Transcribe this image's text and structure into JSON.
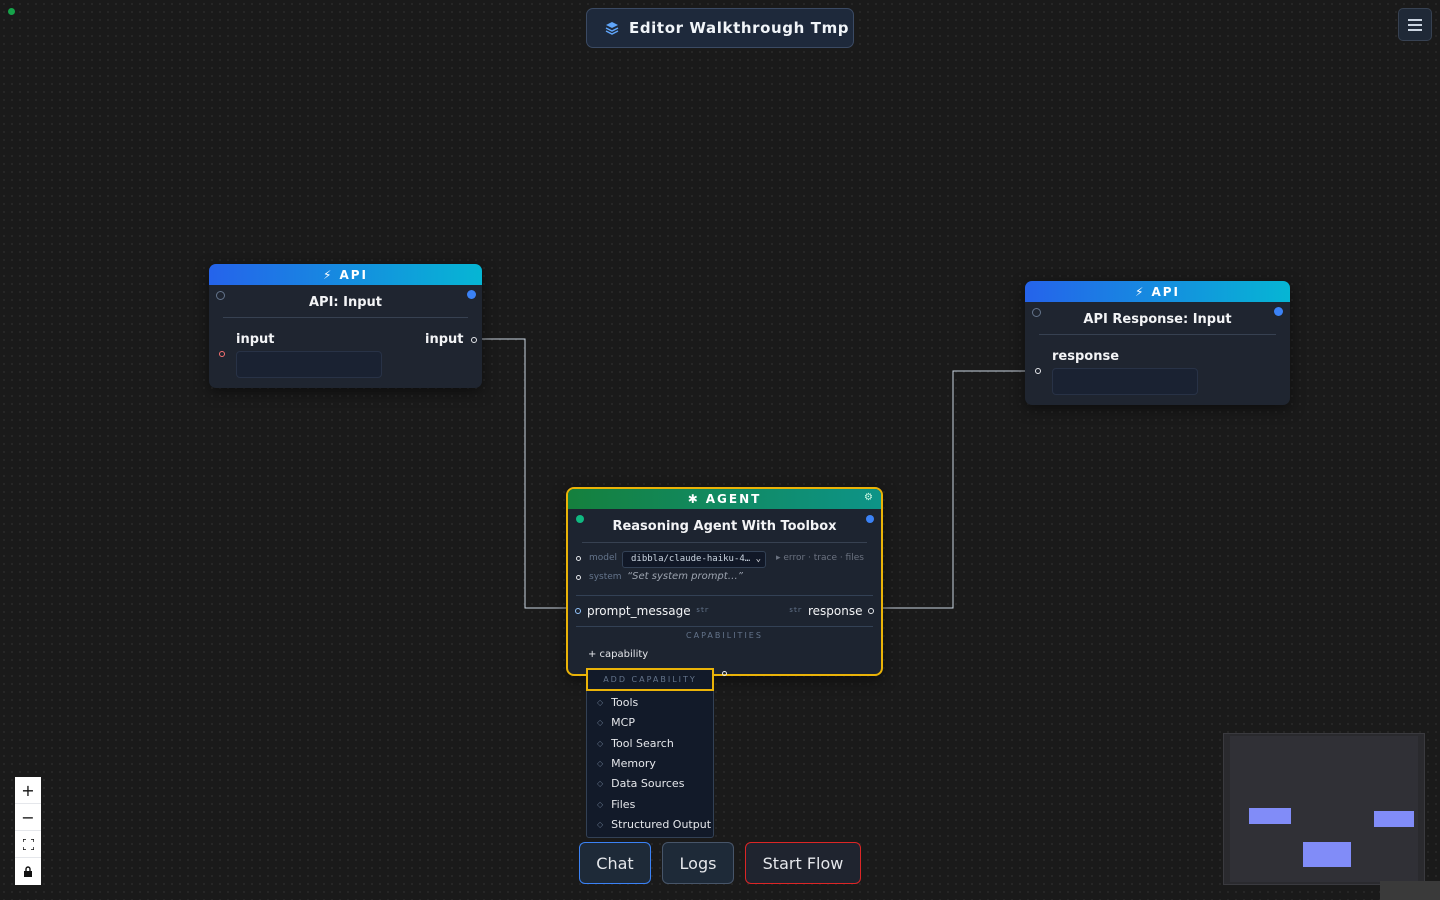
{
  "app": {
    "title": "Editor Walkthrough Tmp"
  },
  "nodes": {
    "api_input": {
      "badge": "API",
      "title": "API: Input",
      "field_label": "input",
      "output_label": "input"
    },
    "agent": {
      "badge": "AGENT",
      "title": "Reasoning Agent With Toolbox",
      "model_label": "model",
      "model_value": "dibbla/claude-haiku-4…",
      "meta_links": "▸ error · trace · files",
      "system_label": "system",
      "system_placeholder": "“Set system prompt…”",
      "input_port": "prompt_message",
      "input_type": "str",
      "output_port": "response",
      "output_type": "str",
      "capabilities_header": "CAPABILITIES",
      "add_capability": "+ capability"
    },
    "api_response": {
      "badge": "API",
      "title": "API Response: Input",
      "field_label": "response"
    }
  },
  "capability_menu": {
    "header": "ADD CAPABILITY",
    "items": [
      "Tools",
      "MCP",
      "Tool Search",
      "Memory",
      "Data Sources",
      "Files",
      "Structured Output"
    ]
  },
  "toolbar": {
    "chat": "Chat",
    "logs": "Logs",
    "start_flow": "Start Flow"
  },
  "zoom_controls": {
    "zoom_in": "+",
    "zoom_out": "−"
  },
  "colors": {
    "accent_blue": "#2563eb",
    "accent_cyan": "#06b6d4",
    "agent_green": "#15803d",
    "selection_yellow": "#eab308",
    "start_red": "#dc2626",
    "minimap_node": "#818cf8"
  }
}
